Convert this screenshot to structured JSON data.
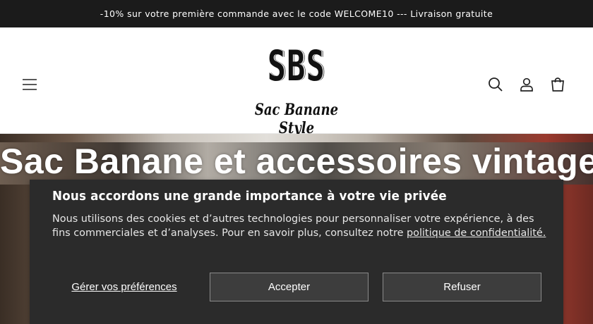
{
  "announcement": {
    "text": "-10% sur votre première commande avec le code WELCOME10 --- Livraison gratuite"
  },
  "header": {
    "logo_mark": "SBS",
    "logo_tagline": "Sac Banane Style",
    "icons": {
      "menu": "hamburger-menu-icon",
      "search": "search-icon",
      "account": "user-icon",
      "cart": "shopping-bag-icon"
    }
  },
  "hero": {
    "title": "Sac Banane et accessoires vintage"
  },
  "cookie_banner": {
    "title": "Nous accordons une grande importance à votre vie privée",
    "text": "Nous utilisons des cookies et d’autres technologies pour personnaliser votre expérience, à des fins commerciales et d’analyses. Pour en savoir plus, consultez notre ",
    "link_text": "politique de confidentialité.",
    "preferences_label": "Gérer vos préférences",
    "accept_label": "Accepter",
    "refuse_label": "Refuser"
  }
}
